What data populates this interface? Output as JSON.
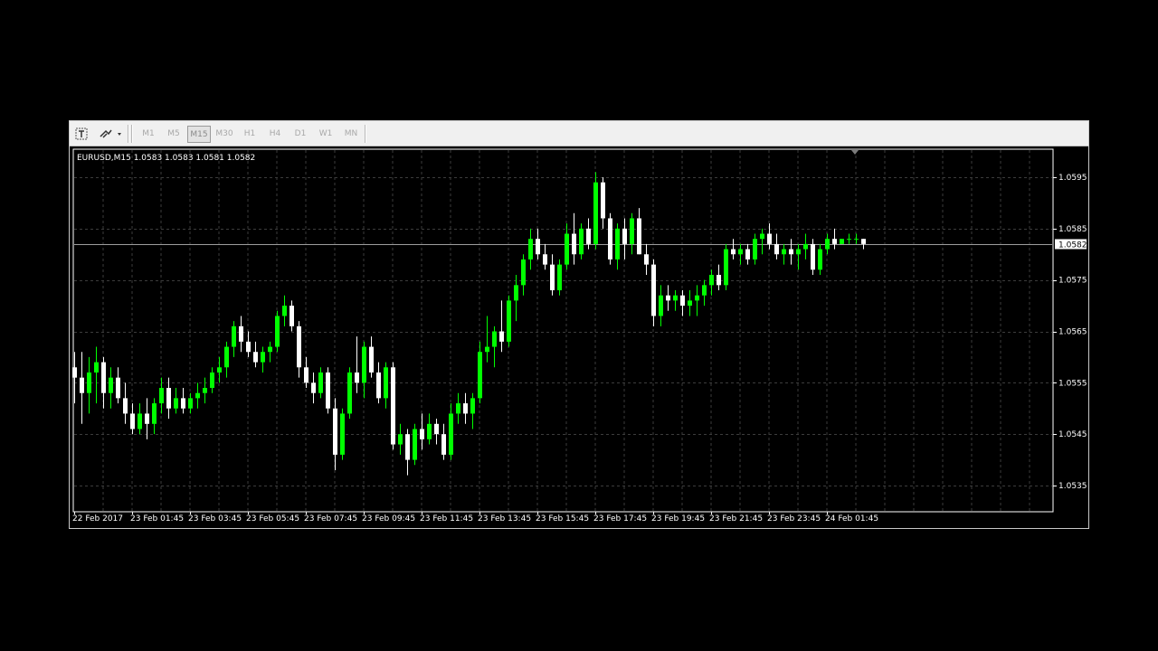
{
  "toolbar": {
    "timeframes": [
      "M1",
      "M5",
      "M15",
      "M30",
      "H1",
      "H4",
      "D1",
      "W1",
      "MN"
    ],
    "active_timeframe": "M15",
    "icons": [
      "text-label-icon",
      "draw-tools-icon"
    ]
  },
  "colors": {
    "background": "#000000",
    "grid": "#3c3c3c",
    "bull": "#00ff00",
    "bear": "#ffffff",
    "bid_line": "#9c9c9c",
    "price_tag_bg": "#ffffff",
    "price_tag_text": "#000000"
  },
  "chart_data": {
    "type": "candlestick",
    "title": "EURUSD,M15  1.0583 1.0583 1.0581 1.0582",
    "symbol": "EURUSD",
    "timeframe": "M15",
    "last_bar": {
      "open": 1.0583,
      "high": 1.0583,
      "low": 1.0581,
      "close": 1.0582
    },
    "current_price": "1.0582",
    "x_tick_labels": [
      "22 Feb 2017",
      "23 Feb 01:45",
      "23 Feb 03:45",
      "23 Feb 05:45",
      "23 Feb 07:45",
      "23 Feb 09:45",
      "23 Feb 11:45",
      "23 Feb 13:45",
      "23 Feb 15:45",
      "23 Feb 17:45",
      "23 Feb 19:45",
      "23 Feb 21:45",
      "23 Feb 23:45",
      "24 Feb 01:45"
    ],
    "y_tick_labels": [
      "1.0595",
      "1.0585",
      "1.0575",
      "1.0565",
      "1.0555",
      "1.0545",
      "1.0535"
    ],
    "y_ticks": [
      1.0595,
      1.0585,
      1.0575,
      1.0565,
      1.0555,
      1.0545,
      1.0535
    ],
    "ylim": [
      1.053,
      1.0599
    ],
    "grid": true,
    "bar_spacing_note": "8 bars per 2-hour grid cell",
    "bars": [
      [
        1.0558,
        1.0561,
        1.0551,
        1.0556
      ],
      [
        1.0556,
        1.0561,
        1.0547,
        1.0553
      ],
      [
        1.0553,
        1.056,
        1.0549,
        1.0557
      ],
      [
        1.0557,
        1.0562,
        1.0551,
        1.0559
      ],
      [
        1.0559,
        1.056,
        1.055,
        1.0553
      ],
      [
        1.0553,
        1.0558,
        1.055,
        1.0556
      ],
      [
        1.0556,
        1.0558,
        1.0551,
        1.0552
      ],
      [
        1.0552,
        1.0555,
        1.0547,
        1.0549
      ],
      [
        1.0549,
        1.0551,
        1.0545,
        1.0546
      ],
      [
        1.0546,
        1.0551,
        1.0545,
        1.0549
      ],
      [
        1.0549,
        1.0552,
        1.0544,
        1.0547
      ],
      [
        1.0547,
        1.0552,
        1.0545,
        1.0551
      ],
      [
        1.0551,
        1.0556,
        1.0549,
        1.0554
      ],
      [
        1.0554,
        1.0556,
        1.0548,
        1.055
      ],
      [
        1.055,
        1.0554,
        1.0549,
        1.0552
      ],
      [
        1.0552,
        1.0554,
        1.0549,
        1.055
      ],
      [
        1.055,
        1.0553,
        1.0549,
        1.0552
      ],
      [
        1.0552,
        1.0555,
        1.055,
        1.0553
      ],
      [
        1.0553,
        1.0556,
        1.0551,
        1.0554
      ],
      [
        1.0554,
        1.0558,
        1.0553,
        1.0557
      ],
      [
        1.0557,
        1.056,
        1.0555,
        1.0558
      ],
      [
        1.0558,
        1.0563,
        1.0556,
        1.0562
      ],
      [
        1.0562,
        1.0567,
        1.056,
        1.0566
      ],
      [
        1.0566,
        1.0568,
        1.0561,
        1.0563
      ],
      [
        1.0563,
        1.0565,
        1.056,
        1.0561
      ],
      [
        1.0561,
        1.0563,
        1.0558,
        1.0559
      ],
      [
        1.0559,
        1.0562,
        1.0557,
        1.0561
      ],
      [
        1.0561,
        1.0563,
        1.0559,
        1.0562
      ],
      [
        1.0562,
        1.0569,
        1.0561,
        1.0568
      ],
      [
        1.0568,
        1.0572,
        1.0566,
        1.057
      ],
      [
        1.057,
        1.0571,
        1.0565,
        1.0566
      ],
      [
        1.0566,
        1.0567,
        1.0556,
        1.0558
      ],
      [
        1.0558,
        1.056,
        1.0554,
        1.0555
      ],
      [
        1.0555,
        1.0557,
        1.0551,
        1.0553
      ],
      [
        1.0553,
        1.0558,
        1.0552,
        1.0557
      ],
      [
        1.0557,
        1.0558,
        1.0549,
        1.055
      ],
      [
        1.055,
        1.0552,
        1.0538,
        1.0541
      ],
      [
        1.0541,
        1.055,
        1.054,
        1.0549
      ],
      [
        1.0549,
        1.0558,
        1.0548,
        1.0557
      ],
      [
        1.0557,
        1.0564,
        1.0553,
        1.0555
      ],
      [
        1.0555,
        1.0563,
        1.0552,
        1.0562
      ],
      [
        1.0562,
        1.0564,
        1.0556,
        1.0557
      ],
      [
        1.0557,
        1.0559,
        1.0551,
        1.0552
      ],
      [
        1.0552,
        1.0559,
        1.055,
        1.0558
      ],
      [
        1.0558,
        1.0559,
        1.0542,
        1.0543
      ],
      [
        1.0543,
        1.0547,
        1.0541,
        1.0545
      ],
      [
        1.0545,
        1.0546,
        1.0537,
        1.054
      ],
      [
        1.054,
        1.0547,
        1.0539,
        1.0546
      ],
      [
        1.0546,
        1.0549,
        1.0542,
        1.0544
      ],
      [
        1.0544,
        1.0549,
        1.0543,
        1.0547
      ],
      [
        1.0547,
        1.0548,
        1.0543,
        1.0545
      ],
      [
        1.0545,
        1.0547,
        1.054,
        1.0541
      ],
      [
        1.0541,
        1.0551,
        1.054,
        1.0549
      ],
      [
        1.0549,
        1.0553,
        1.0547,
        1.0551
      ],
      [
        1.0551,
        1.0553,
        1.0547,
        1.0549
      ],
      [
        1.0549,
        1.0553,
        1.0546,
        1.0552
      ],
      [
        1.0552,
        1.0563,
        1.0551,
        1.0561
      ],
      [
        1.0561,
        1.0568,
        1.0559,
        1.0562
      ],
      [
        1.0562,
        1.0566,
        1.0558,
        1.0565
      ],
      [
        1.0565,
        1.0571,
        1.0561,
        1.0563
      ],
      [
        1.0563,
        1.0572,
        1.0562,
        1.0571
      ],
      [
        1.0571,
        1.0576,
        1.0567,
        1.0574
      ],
      [
        1.0574,
        1.058,
        1.0572,
        1.0579
      ],
      [
        1.0579,
        1.0585,
        1.0577,
        1.0583
      ],
      [
        1.0583,
        1.0585,
        1.0579,
        1.058
      ],
      [
        1.058,
        1.0582,
        1.0577,
        1.0578
      ],
      [
        1.0578,
        1.058,
        1.0572,
        1.0573
      ],
      [
        1.0573,
        1.0579,
        1.0572,
        1.0578
      ],
      [
        1.0578,
        1.0586,
        1.0577,
        1.0584
      ],
      [
        1.0584,
        1.0588,
        1.0578,
        1.058
      ],
      [
        1.058,
        1.0586,
        1.0579,
        1.0585
      ],
      [
        1.0585,
        1.0587,
        1.0581,
        1.0582
      ],
      [
        1.0582,
        1.0596,
        1.0581,
        1.0594
      ],
      [
        1.0594,
        1.0595,
        1.0585,
        1.0587
      ],
      [
        1.0587,
        1.0588,
        1.0578,
        1.0579
      ],
      [
        1.0579,
        1.0586,
        1.0577,
        1.0585
      ],
      [
        1.0585,
        1.0587,
        1.0579,
        1.0582
      ],
      [
        1.0582,
        1.0588,
        1.058,
        1.0587
      ],
      [
        1.0587,
        1.0589,
        1.058,
        1.058
      ],
      [
        1.058,
        1.0582,
        1.0576,
        1.0578
      ],
      [
        1.0578,
        1.0579,
        1.0566,
        1.0568
      ],
      [
        1.0568,
        1.0574,
        1.0566,
        1.0572
      ],
      [
        1.0572,
        1.0574,
        1.0569,
        1.0571
      ],
      [
        1.0571,
        1.0573,
        1.0569,
        1.0572
      ],
      [
        1.0572,
        1.0573,
        1.0568,
        1.057
      ],
      [
        1.057,
        1.0573,
        1.0568,
        1.0571
      ],
      [
        1.0571,
        1.0574,
        1.0568,
        1.0572
      ],
      [
        1.0572,
        1.0575,
        1.057,
        1.0574
      ],
      [
        1.0574,
        1.0577,
        1.0572,
        1.0576
      ],
      [
        1.0576,
        1.0578,
        1.0573,
        1.0574
      ],
      [
        1.0574,
        1.0582,
        1.0573,
        1.0581
      ],
      [
        1.0581,
        1.0583,
        1.0579,
        1.058
      ],
      [
        1.058,
        1.0582,
        1.0578,
        1.0581
      ],
      [
        1.0581,
        1.0582,
        1.0578,
        1.0579
      ],
      [
        1.0579,
        1.0584,
        1.0578,
        1.0583
      ],
      [
        1.0583,
        1.0585,
        1.058,
        1.0584
      ],
      [
        1.0584,
        1.0586,
        1.0581,
        1.0582
      ],
      [
        1.0582,
        1.0584,
        1.0579,
        1.058
      ],
      [
        1.058,
        1.0582,
        1.0578,
        1.0581
      ],
      [
        1.0581,
        1.0583,
        1.0578,
        1.058
      ],
      [
        1.058,
        1.0582,
        1.0577,
        1.0581
      ],
      [
        1.0581,
        1.0584,
        1.0579,
        1.0582
      ],
      [
        1.0582,
        1.0583,
        1.0576,
        1.0577
      ],
      [
        1.0577,
        1.0582,
        1.0576,
        1.0581
      ],
      [
        1.0581,
        1.0584,
        1.058,
        1.0583
      ],
      [
        1.0583,
        1.0585,
        1.0581,
        1.0582
      ],
      [
        1.0582,
        1.0583,
        1.0582,
        1.0583
      ],
      [
        1.0583,
        1.0584,
        1.0582,
        1.0583
      ],
      [
        1.0583,
        1.0584,
        1.0582,
        1.0583
      ],
      [
        1.0583,
        1.0583,
        1.0581,
        1.0582
      ]
    ]
  }
}
